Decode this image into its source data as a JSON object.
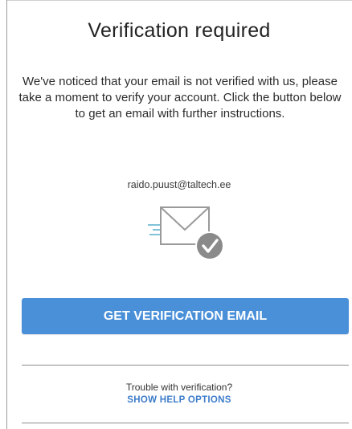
{
  "dialog": {
    "title": "Verification required",
    "message": "We've noticed that your email is not verified with us, please take a moment to verify your account. Click the button below to get an email with further instructions.",
    "email": "raido.puust@taltech.ee",
    "illustration_icon": "envelope-check-icon",
    "primary_button_label": "GET VERIFICATION EMAIL"
  },
  "help": {
    "question": "Trouble with verification?",
    "link_label": "SHOW HELP OPTIONS"
  },
  "colors": {
    "primary": "#4a90d9",
    "link": "#3d7cc9",
    "check_badge": "#8a8a8a"
  }
}
